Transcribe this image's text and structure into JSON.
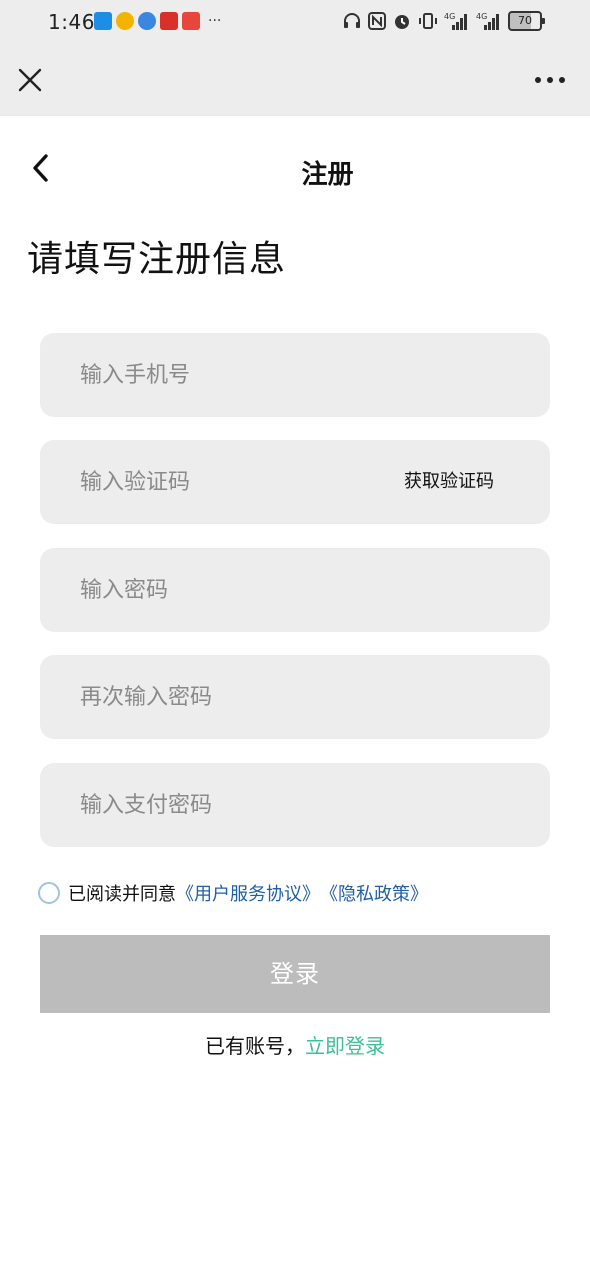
{
  "status_bar": {
    "time": "1:46",
    "battery": "70",
    "network_left": "4G",
    "network_right": "4G",
    "app_icon_colors": [
      "#1e8de6",
      "#f2b400",
      "#3b86e0",
      "#d9302c",
      "#e8463c"
    ]
  },
  "page": {
    "title": "注册",
    "heading": "请填写注册信息"
  },
  "form": {
    "phone": {
      "placeholder": "输入手机号",
      "value": ""
    },
    "code": {
      "placeholder": "输入验证码",
      "value": "",
      "button_label": "获取验证码"
    },
    "password": {
      "placeholder": "输入密码",
      "value": ""
    },
    "password_confirm": {
      "placeholder": "再次输入密码",
      "value": ""
    },
    "pay_password": {
      "placeholder": "输入支付密码",
      "value": ""
    }
  },
  "agreement": {
    "checked": false,
    "text": "已阅读并同意",
    "terms_link": "《用户服务协议》",
    "privacy_link": "《隐私政策》"
  },
  "submit": {
    "label": "登录"
  },
  "login_hint": {
    "text": "已有账号，",
    "link": "立即登录"
  },
  "colors": {
    "link_blue": "#1f5fa8",
    "link_green": "#3dbf95",
    "button_disabled": "#bcbcbc",
    "input_bg": "#ededed"
  }
}
